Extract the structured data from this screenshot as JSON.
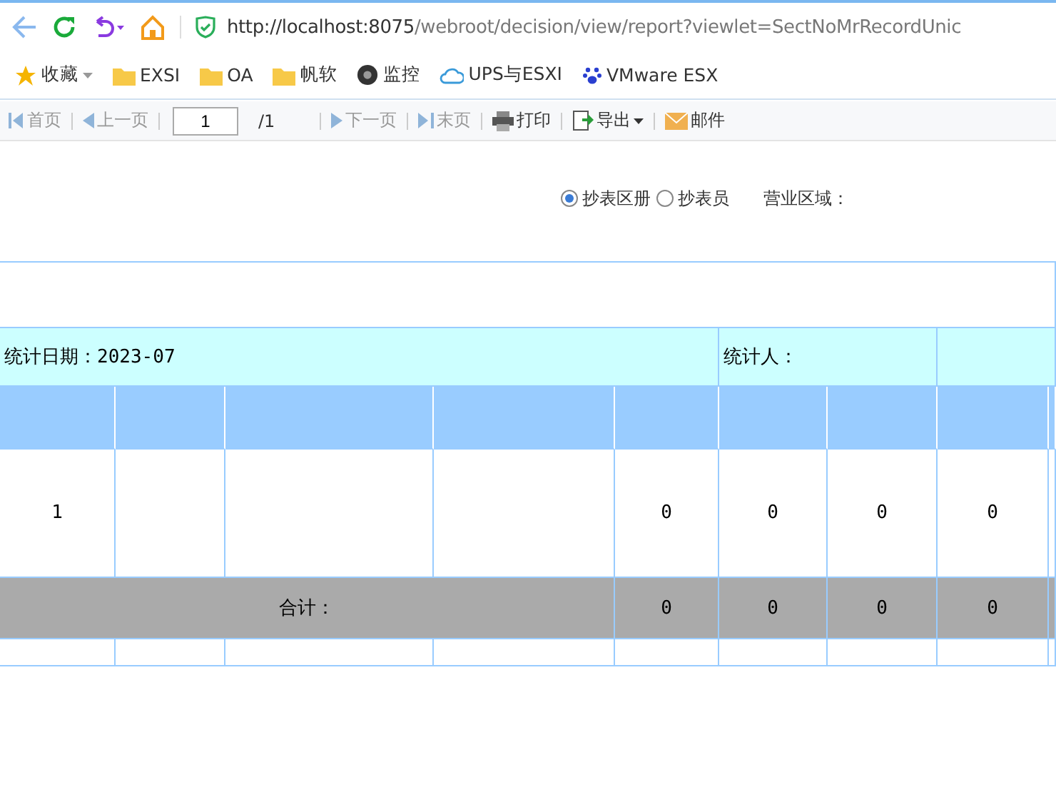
{
  "browser": {
    "url_host": "http://localhost:8075",
    "url_path": "/webroot/decision/view/report?viewlet=SectNoMrRecordUnic"
  },
  "bookmarks": [
    {
      "kind": "star",
      "label": "收藏"
    },
    {
      "kind": "folder",
      "label": "EXSI"
    },
    {
      "kind": "folder",
      "label": "OA"
    },
    {
      "kind": "folder",
      "label": "帆软"
    },
    {
      "kind": "camera",
      "label": "监控"
    },
    {
      "kind": "cloud",
      "label": "UPS与ESXI"
    },
    {
      "kind": "paw",
      "label": "VMware ESX"
    }
  ],
  "toolbar": {
    "items": [
      {
        "kind": "first",
        "label": "首页",
        "disabled": true
      },
      {
        "kind": "prev",
        "label": "上一页",
        "disabled": true
      },
      {
        "kind": "page",
        "value": "1",
        "total": "/1"
      },
      {
        "kind": "next",
        "label": "下一页",
        "disabled": true
      },
      {
        "kind": "last",
        "label": "末页",
        "disabled": true
      },
      {
        "kind": "print",
        "label": "打印",
        "disabled": false
      },
      {
        "kind": "export",
        "label": "导出",
        "disabled": false
      },
      {
        "kind": "mail",
        "label": "邮件",
        "disabled": false
      }
    ]
  },
  "filters": {
    "options": [
      {
        "label": "抄表区册",
        "selected": true
      },
      {
        "label": "抄表员",
        "selected": false
      }
    ],
    "region_label": "营业区域："
  },
  "report": {
    "info": {
      "date": "统计日期：2023-07",
      "person": "统计人："
    },
    "row": {
      "index": "1",
      "values": [
        "0",
        "0",
        "0",
        "0"
      ]
    },
    "total": {
      "label": "合计：",
      "values": [
        "0",
        "0",
        "0",
        "0"
      ]
    }
  }
}
